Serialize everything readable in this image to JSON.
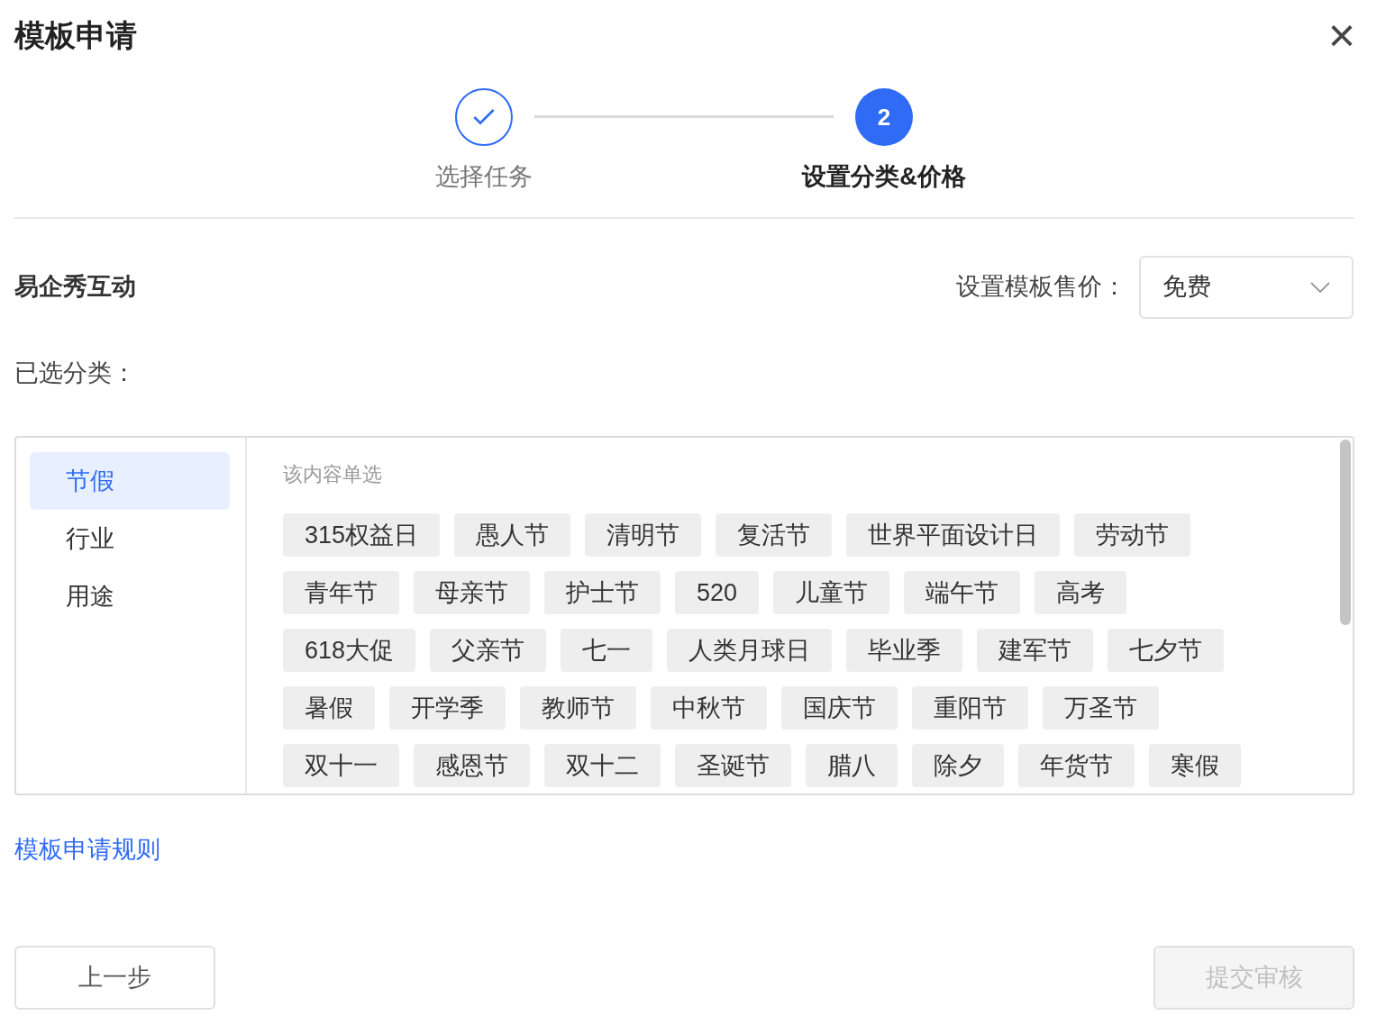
{
  "dialog": {
    "title": "模板申请",
    "close": "×"
  },
  "steps": [
    {
      "label": "选择任务",
      "done": true,
      "active": false
    },
    {
      "label": "设置分类&价格",
      "number": "2",
      "done": false,
      "active": true
    }
  ],
  "owner": "易企秀互动",
  "price": {
    "label": "设置模板售价：",
    "value": "免费"
  },
  "selected_label": "已选分类：",
  "categories": [
    {
      "label": "节假",
      "selected": true
    },
    {
      "label": "行业",
      "selected": false
    },
    {
      "label": "用途",
      "selected": false
    }
  ],
  "hint": "该内容单选",
  "tags": [
    "315权益日",
    "愚人节",
    "清明节",
    "复活节",
    "世界平面设计日",
    "劳动节",
    "青年节",
    "母亲节",
    "护士节",
    "520",
    "儿童节",
    "端午节",
    "高考",
    "618大促",
    "父亲节",
    "七一",
    "人类月球日",
    "毕业季",
    "建军节",
    "七夕节",
    "暑假",
    "开学季",
    "教师节",
    "中秋节",
    "国庆节",
    "重阳节",
    "万圣节",
    "双十一",
    "感恩节",
    "双十二",
    "圣诞节",
    "腊八",
    "除夕",
    "年货节",
    "寒假"
  ],
  "rules_link": "模板申请规则",
  "buttons": [
    {
      "label": "上一步",
      "disabled": false
    },
    {
      "label": "提交审核",
      "disabled": true
    }
  ]
}
